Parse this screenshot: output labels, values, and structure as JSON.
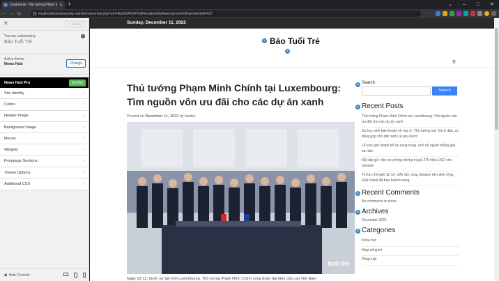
{
  "browser": {
    "tab_title": "Customize: Thủ tướng Phạm Minh",
    "url": "localhost/wordpress/wp-admin/customize.php?url=http%3A%2F%2Flocalhost%2Fwordpress%2Farchive%2F437"
  },
  "sidebar": {
    "publish_label": "Published",
    "customizing_label": "You are customizing",
    "site_name": "Báo Tuổi Trẻ",
    "active_theme_label": "Active theme",
    "theme_name": "News Hub",
    "change_label": "Change",
    "pro_label": "News Hub Pro",
    "pro_button": "Go Pro",
    "menu_items": [
      {
        "label": "Site Identity"
      },
      {
        "label": "Colors"
      },
      {
        "label": "Header Image"
      },
      {
        "label": "Background Image"
      },
      {
        "label": "Menus"
      },
      {
        "label": "Widgets"
      },
      {
        "label": "Frontpage Sections"
      },
      {
        "label": "Theme Options"
      },
      {
        "label": "Additional CSS"
      }
    ],
    "hide_controls": "Hide Controls"
  },
  "preview": {
    "date": "Sunday, December 11, 2022",
    "site_title": "Báo Tuổi Trẻ",
    "article": {
      "title": "Thủ tướng Phạm Minh Chính tại Luxembourg: Tìm nguồn vốn ưu đãi cho các dự án xanh",
      "posted_on": "Posted on",
      "date": "December 11, 2022",
      "by": "by",
      "author": "tuoitre",
      "excerpt": "Ngày 10-12, trước sự tận tình Luxembourg, Thủ tướng Phạm Minh Chính cùng đoàn đại biểu cấp cao Việt Nam",
      "image_watermark": "tuổi trẻ"
    },
    "search": {
      "label": "Search",
      "button": "Search"
    },
    "recent_posts": {
      "title": "Recent Posts",
      "items": [
        "Thủ tướng Phạm Minh Chính tại Luxembourg: Tìm nguồn vốn ưu đãi cho các dự án xanh",
        "Du học sinh bán khoản về hay ở, Thủ tướng nói: 'Dù ở đâu, cứ đóng góp cho đất nước là yêu nước'",
        "Lễ trao giải Nobel trở lại sang trọng, mới đủ người thắng giải ba năm",
        "Mỹ sắp gửi viện trợ phòng không trị giá 275 triệu USD cho Ukraine",
        "Tin tức thế giới 11-12: UAV tấn công Ukraine trên diện rộng; Giải Nobel đã trao hoành tráng"
      ]
    },
    "recent_comments": {
      "title": "Recent Comments",
      "empty": "No comments to show."
    },
    "archives": {
      "title": "Archives",
      "items": [
        "December 2022"
      ]
    },
    "categories": {
      "title": "Categories",
      "items": [
        "Khoa học",
        "Nhịp sống trẻ",
        "Pháp luật"
      ]
    }
  }
}
